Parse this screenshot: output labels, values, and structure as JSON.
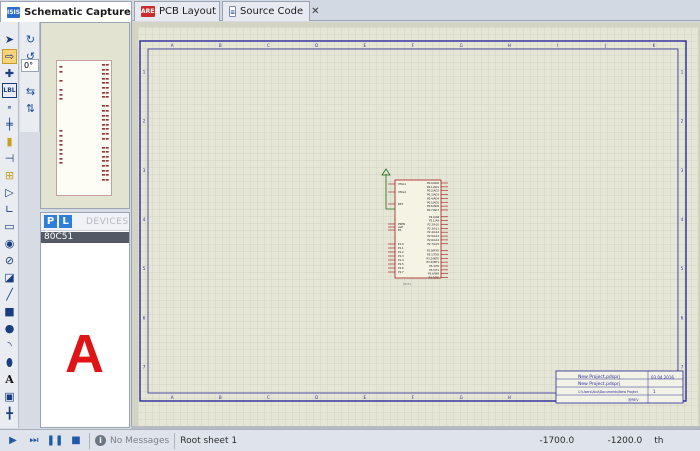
{
  "tabs": [
    {
      "label": "Schematic Capture",
      "icon": "isis-icon",
      "icon_text": "ISIS",
      "active": true
    },
    {
      "label": "PCB Layout",
      "icon": "ares-icon",
      "icon_text": "ARES",
      "active": false
    },
    {
      "label": "Source Code",
      "icon": "source-code-icon",
      "icon_text": "",
      "active": false
    }
  ],
  "tools": {
    "rotation_value": "0°",
    "text_tool_glyph": "A",
    "label_tool_glyph": "LBL"
  },
  "devices": {
    "pick_label": "P",
    "library_label": "L",
    "title": "DEVICES",
    "items": [
      "80C51"
    ],
    "selected": "80C51"
  },
  "decorative_letter": "A",
  "schematic": {
    "grid_columns": [
      "A",
      "B",
      "C",
      "D",
      "E",
      "F",
      "G",
      "H",
      "I",
      "J",
      "K"
    ],
    "grid_rows": [
      "1",
      "2",
      "3",
      "4",
      "5",
      "6",
      "7"
    ],
    "component": {
      "pins_left": [
        "XTAL1",
        "XTAL2",
        "RST",
        "PSEN",
        "ALE",
        "EA",
        "P1.0",
        "P1.1",
        "P1.2",
        "P1.3",
        "P1.4",
        "P1.5",
        "P1.6",
        "P1.7"
      ],
      "pins_right": [
        "P0.0/AD0",
        "P0.1/AD1",
        "P0.2/AD2",
        "P0.3/AD3",
        "P0.4/AD4",
        "P0.5/AD5",
        "P0.6/AD6",
        "P0.7/AD7",
        "P2.0/A8",
        "P2.1/A9",
        "P2.2/A10",
        "P2.3/A11",
        "P2.4/A12",
        "P2.5/A13",
        "P2.6/A14",
        "P2.7/A15",
        "P3.0/RXD",
        "P3.1/TXD",
        "P3.2/INT0",
        "P3.3/INT1",
        "P3.4/T0",
        "P3.5/T1",
        "P3.6/WR",
        "P3.7/RD"
      ]
    },
    "title_block": {
      "title_value": "New Project.pdsprj",
      "design_value": "New Project.pdsprj",
      "path_value": "C:\\Users\\Atul\\Documents\\New Project",
      "date_value": "03.04.2016",
      "page_value": "1",
      "rev_label": "@REV"
    }
  },
  "status": {
    "messages": "No Messages",
    "sheet": "Root sheet 1",
    "coord_x": "-1700.0",
    "coord_y": "-1200.0",
    "unit": "th"
  },
  "colors": {
    "sheet_bg": "#e6e6d6",
    "grid_line": "#bfc2b2",
    "border_blue": "#2a2a9a",
    "component_red": "#a01818",
    "accent_red": "#e01414",
    "device_selected": "#535a65"
  }
}
